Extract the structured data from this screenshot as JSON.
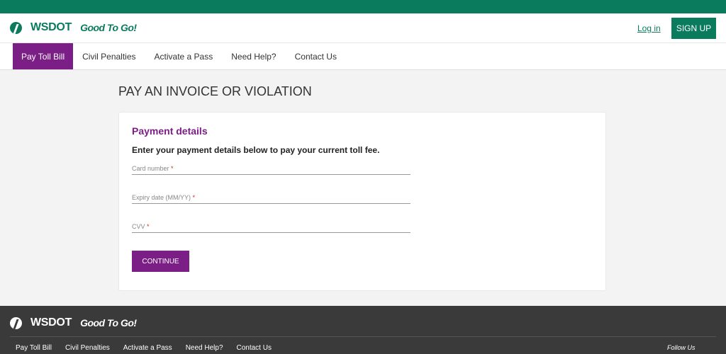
{
  "header": {
    "brand": "WSDOT",
    "tagline": "Good To Go!",
    "login": "Log in",
    "signup": "SIGN UP"
  },
  "nav": [
    "Pay Toll Bill",
    "Civil Penalties",
    "Activate a Pass",
    "Need Help?",
    "Contact Us"
  ],
  "page": {
    "title": "PAY AN INVOICE OR VIOLATION"
  },
  "form": {
    "heading": "Payment details",
    "subtitle": "Enter your payment details below to pay your current toll fee.",
    "fields": [
      {
        "label": "Card number",
        "required": "*"
      },
      {
        "label": "Expiry date (MM/YY)",
        "required": "*"
      },
      {
        "label": "CVV",
        "required": "*"
      }
    ],
    "continue": "CONTINUE"
  },
  "footer": {
    "brand": "WSDOT",
    "tagline": "Good To Go!",
    "links": [
      "Pay Toll Bill",
      "Civil Penalties",
      "Activate a Pass",
      "Need Help?",
      "Contact Us"
    ],
    "follow": "Follow Us"
  }
}
